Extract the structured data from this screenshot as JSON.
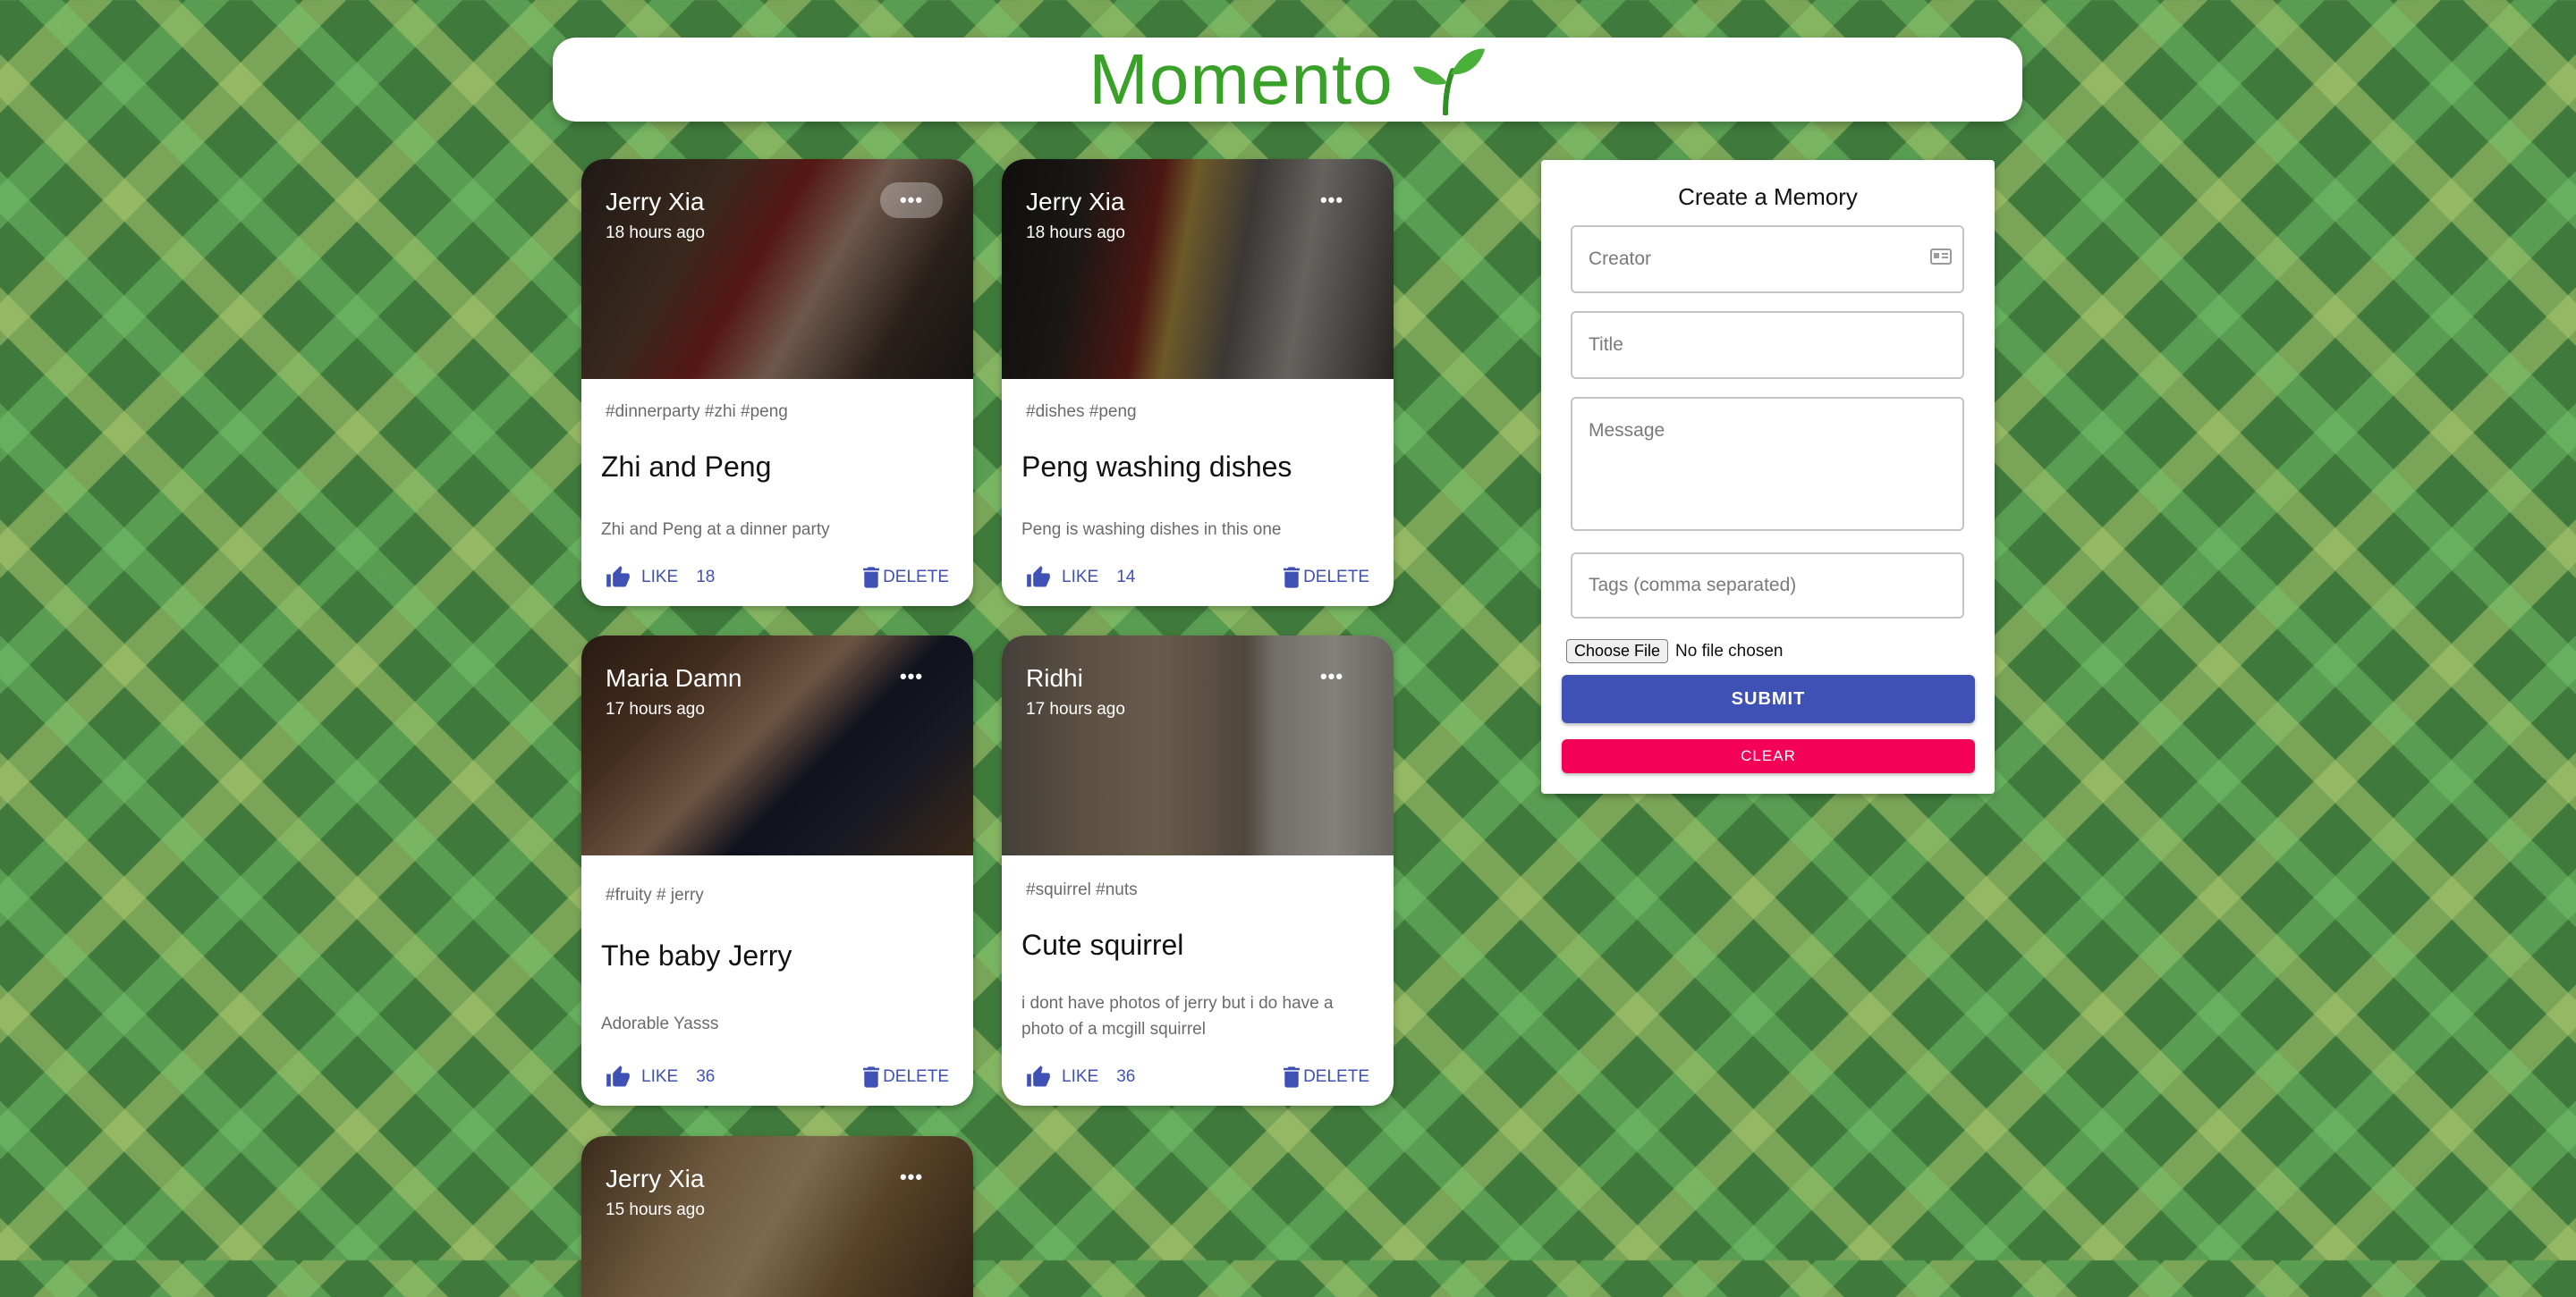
{
  "app": {
    "title": "Momento"
  },
  "posts": [
    {
      "author": "Jerry Xia",
      "time": "18 hours ago",
      "tags": "#dinnerparty #zhi #peng",
      "title": "Zhi and Peng",
      "message": "Zhi and Peng at a dinner party",
      "like_label": "LIKE",
      "likes": "18",
      "delete_label": "DELETE"
    },
    {
      "author": "Jerry Xia",
      "time": "18 hours ago",
      "tags": "#dishes #peng",
      "title": "Peng washing dishes",
      "message": "Peng is washing dishes in this one",
      "like_label": "LIKE",
      "likes": "14",
      "delete_label": "DELETE"
    },
    {
      "author": "Maria Damn",
      "time": "17 hours ago",
      "tags": "#fruity # jerry",
      "title": "The baby Jerry",
      "message": "Adorable Yasss",
      "like_label": "LIKE",
      "likes": "36",
      "delete_label": "DELETE"
    },
    {
      "author": "Ridhi",
      "time": "17 hours ago",
      "tags": "#squirrel #nuts",
      "title": "Cute squirrel",
      "message": "i dont have photos of jerry but i do have a photo of a mcgill squirrel",
      "like_label": "LIKE",
      "likes": "36",
      "delete_label": "DELETE"
    },
    {
      "author": "Jerry Xia",
      "time": "15 hours ago"
    }
  ],
  "form": {
    "heading": "Create a Memory",
    "creator_placeholder": "Creator",
    "title_placeholder": "Title",
    "message_placeholder": "Message",
    "tags_placeholder": "Tags (comma separated)",
    "file_button": "Choose File",
    "file_status": "No file chosen",
    "submit_label": "SUBMIT",
    "clear_label": "CLEAR"
  },
  "icons": {
    "more": "more-horizontal-icon",
    "like": "thumb-up-icon",
    "delete": "trash-icon",
    "logo": "sprout-icon",
    "autofill": "contact-card-icon"
  },
  "colors": {
    "brand": "#3aa128",
    "primary": "#3f51b5",
    "secondary": "#f50057"
  }
}
